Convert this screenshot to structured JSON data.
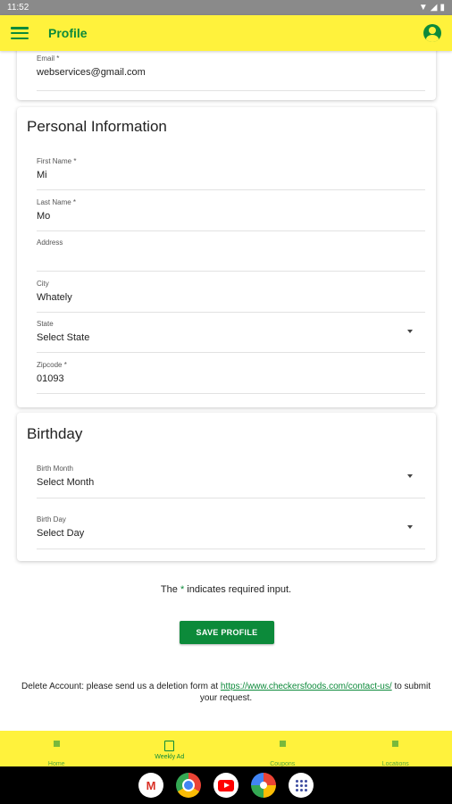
{
  "status_bar": {
    "time": "11:52"
  },
  "app_bar": {
    "title": "Profile"
  },
  "account": {
    "email_label": "Email",
    "email_value": "webservices@gmail.com"
  },
  "personal": {
    "title": "Personal Information",
    "first_name_label": "First Name",
    "first_name_value": "Mi",
    "last_name_label": "Last Name",
    "last_name_value": "Mo",
    "address_label": "Address",
    "address_value": "",
    "city_label": "City",
    "city_value": "Whately",
    "state_label": "State",
    "state_value": "Select State",
    "zipcode_label": "Zipcode",
    "zipcode_value": "01093"
  },
  "birthday": {
    "title": "Birthday",
    "month_label": "Birth Month",
    "month_value": "Select Month",
    "day_label": "Birth Day",
    "day_value": "Select Day"
  },
  "required_symbol": "*",
  "required_note_prefix": "The",
  "required_note_suffix": "indicates required input.",
  "save_label": "SAVE PROFILE",
  "delete_note": {
    "text_before": "Delete Account: please send us a deletion form at",
    "link": "https://www.checkersfoods.com/contact-us/",
    "text_after": "to submit your request."
  },
  "bottom_nav": {
    "items": [
      {
        "label": "Home",
        "icon": "home-icon"
      },
      {
        "label": "Weekly Ad",
        "icon": "newspaper-icon"
      },
      {
        "label": "Coupons",
        "icon": "scissors-icon"
      },
      {
        "label": "Locations",
        "icon": "location-pin-icon"
      }
    ],
    "active_index": 1
  },
  "colors": {
    "brand_yellow": "#fff23c",
    "brand_green": "#0c8a3a"
  }
}
